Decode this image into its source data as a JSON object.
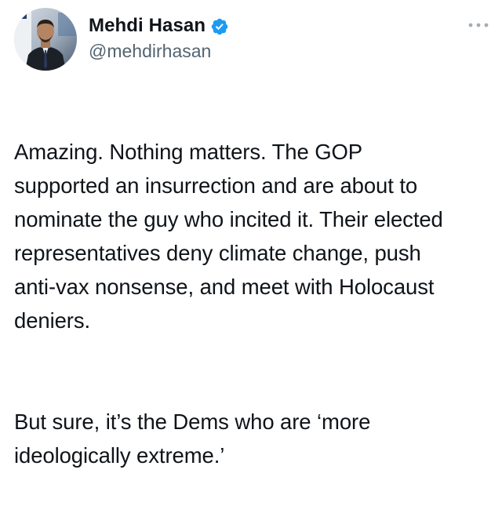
{
  "tweet": {
    "author": {
      "display_name": "Mehdi Hasan",
      "handle": "@mehdirhasan",
      "verified": true,
      "avatar": "avatar-photo-man-in-suit"
    },
    "more_icon": "more-horizontal-icon",
    "verified_icon": "verified-badge-icon",
    "accent_color": "#1d9bf0",
    "paragraphs": [
      "Amazing. Nothing matters. The GOP\nsupported an insurrection and are about to\nnominate the guy who incited it. Their elected\nrepresentatives deny climate change, push\nanti-vax nonsense, and meet with Holocaust\ndeniers.",
      "But sure, it’s the Dems who are ‘more\nideologically extreme.’"
    ]
  }
}
